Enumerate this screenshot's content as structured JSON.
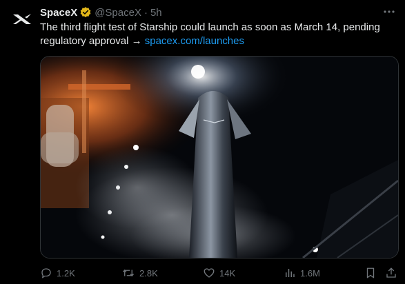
{
  "tweet": {
    "author": {
      "name": "SpaceX",
      "handle": "@SpaceX",
      "separator": "·",
      "time": "5h",
      "verified": true
    },
    "text_main": "The third flight test of Starship could launch as soon as March 14, pending regulatory approval → ",
    "link_text": "spacex.com/launches",
    "media": {
      "description_icon": "rocket-photo"
    },
    "stats": {
      "replies": "1.2K",
      "reposts": "2.8K",
      "likes": "14K",
      "views": "1.6M"
    }
  },
  "colors": {
    "background": "#000000",
    "text": "#e7e9ea",
    "muted": "#71767b",
    "link": "#1d9bf0",
    "verified_gold": "#e2b719"
  }
}
